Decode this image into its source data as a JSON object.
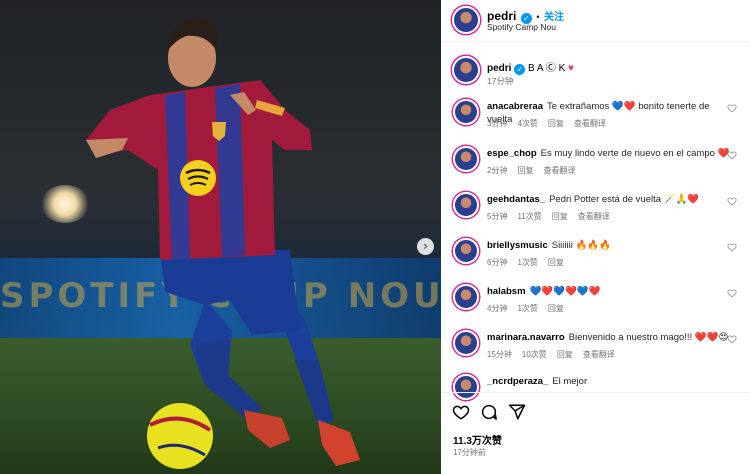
{
  "photo": {
    "banner_text": "SPOTIFY CAMP NOU",
    "next_glyph": "›"
  },
  "header": {
    "username": "pedri",
    "verified_glyph": "✓",
    "separator": "•",
    "follow_label": "关注",
    "location": "Spotify Camp Nou"
  },
  "caption": {
    "username": "pedri",
    "text": "B A Ⓒ K",
    "time": "17分钟"
  },
  "comments": [
    {
      "username": "anacabreraa",
      "text": "Te extrañamos 💙❤️ bonito tenerte de vuelta",
      "time": "3分钟",
      "likes": "4次赞",
      "reply": "回复",
      "translate": "查看翻译"
    },
    {
      "username": "espe_chop",
      "text": "Es muy lindo verte de nuevo en el campo ❤️",
      "time": "2分钟",
      "likes": "",
      "reply": "回复",
      "translate": "查看翻译"
    },
    {
      "username": "geehdantas_",
      "text": "Pedri Potter está de vuelta 🪄🙏❤️",
      "time": "5分钟",
      "likes": "11次赞",
      "reply": "回复",
      "translate": "查看翻译"
    },
    {
      "username": "briellysmusic",
      "text": "Siiiiiii 🔥🔥🔥",
      "time": "6分钟",
      "likes": "1次赞",
      "reply": "回复",
      "translate": ""
    },
    {
      "username": "halabsm",
      "text": "💙❤️💙❤️💙❤️",
      "time": "4分钟",
      "likes": "1次赞",
      "reply": "回复",
      "translate": ""
    },
    {
      "username": "marinara.navarro",
      "text": "Bienvenido a nuestro mago!!! ❤️❤️😍",
      "time": "15分钟",
      "likes": "10次赞",
      "reply": "回复",
      "translate": "查看翻译"
    },
    {
      "username": "_ncrdperaza_",
      "text": "El mejor",
      "time": "",
      "likes": "",
      "reply": "",
      "translate": ""
    }
  ],
  "footer": {
    "likes": "11.3万次赞",
    "time": "17分钟前"
  },
  "icons": {
    "like": "heart-icon",
    "comment": "comment-icon",
    "share": "share-icon",
    "comment_like": "small-heart-icon"
  }
}
